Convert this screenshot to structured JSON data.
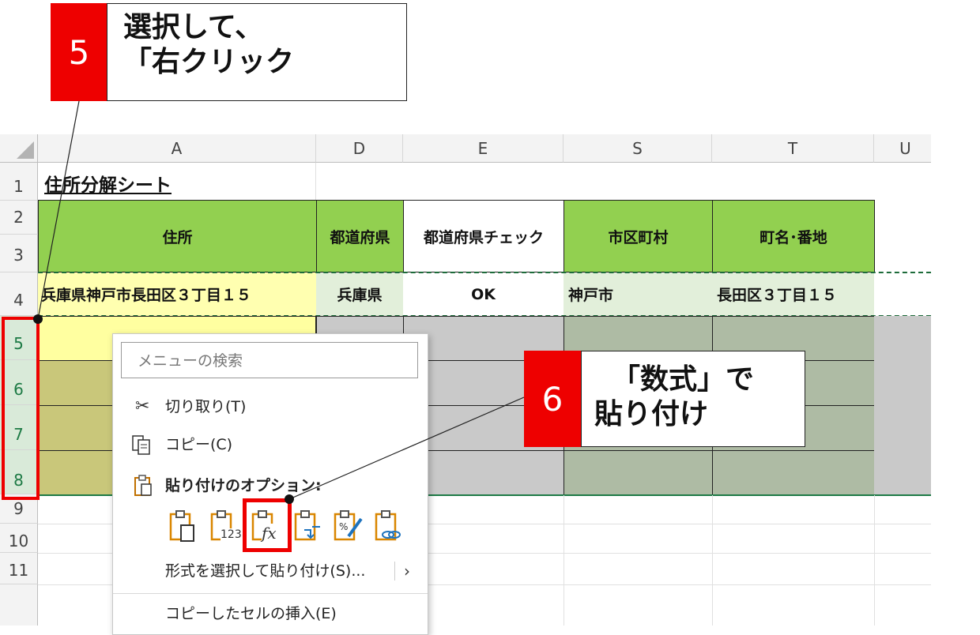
{
  "callout5": {
    "number": "5",
    "line1": "選択して、",
    "line2": "「右クリック"
  },
  "callout6": {
    "number": "6",
    "line1": "「数式」で",
    "line2": "貼り付け"
  },
  "sheet": {
    "columns": [
      "A",
      "D",
      "E",
      "S",
      "T",
      "U"
    ],
    "rows": [
      "1",
      "2",
      "3",
      "4",
      "5",
      "6",
      "7",
      "8",
      "9",
      "10",
      "11"
    ],
    "title": "住所分解シート",
    "headers": {
      "address": "住所",
      "prefecture": "都道府県",
      "pref_check": "都道府県チェック",
      "city": "市区町村",
      "town": "町名･番地"
    },
    "row4": {
      "address": "兵庫県神戸市長田区３丁目１５",
      "prefecture": "兵庫県",
      "pref_check": "OK",
      "city": "神戸市",
      "town": "長田区３丁目１５"
    }
  },
  "context_menu": {
    "search_placeholder": "メニューの検索",
    "cut": "切り取り(T)",
    "copy": "コピー(C)",
    "paste_options": "貼り付けのオプション:",
    "paste_special": "形式を選択して貼り付け(S)...",
    "insert_copied": "コピーしたセルの挿入(E)",
    "paste_icons": [
      "paste-icon",
      "paste-values-icon",
      "paste-formulas-icon",
      "paste-transpose-icon",
      "paste-formatting-icon",
      "paste-link-icon"
    ],
    "paste_values_label": "123",
    "formula_label": "fx"
  },
  "colors": {
    "accent_red": "#ee0000",
    "header_green": "#92d050",
    "selection_green": "#1d7a45"
  }
}
